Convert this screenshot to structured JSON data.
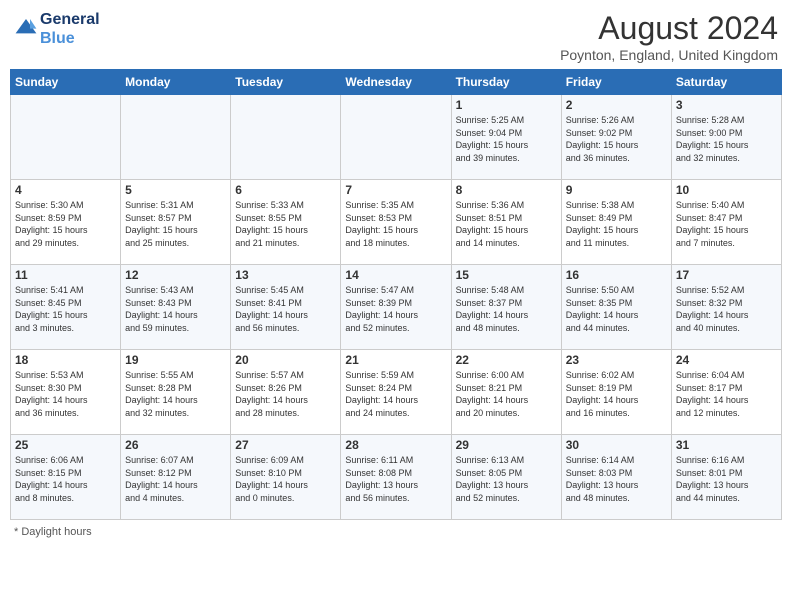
{
  "header": {
    "logo_line1": "General",
    "logo_line2": "Blue",
    "month_year": "August 2024",
    "location": "Poynton, England, United Kingdom"
  },
  "days_of_week": [
    "Sunday",
    "Monday",
    "Tuesday",
    "Wednesday",
    "Thursday",
    "Friday",
    "Saturday"
  ],
  "weeks": [
    [
      {
        "day": "",
        "info": ""
      },
      {
        "day": "",
        "info": ""
      },
      {
        "day": "",
        "info": ""
      },
      {
        "day": "",
        "info": ""
      },
      {
        "day": "1",
        "info": "Sunrise: 5:25 AM\nSunset: 9:04 PM\nDaylight: 15 hours\nand 39 minutes."
      },
      {
        "day": "2",
        "info": "Sunrise: 5:26 AM\nSunset: 9:02 PM\nDaylight: 15 hours\nand 36 minutes."
      },
      {
        "day": "3",
        "info": "Sunrise: 5:28 AM\nSunset: 9:00 PM\nDaylight: 15 hours\nand 32 minutes."
      }
    ],
    [
      {
        "day": "4",
        "info": "Sunrise: 5:30 AM\nSunset: 8:59 PM\nDaylight: 15 hours\nand 29 minutes."
      },
      {
        "day": "5",
        "info": "Sunrise: 5:31 AM\nSunset: 8:57 PM\nDaylight: 15 hours\nand 25 minutes."
      },
      {
        "day": "6",
        "info": "Sunrise: 5:33 AM\nSunset: 8:55 PM\nDaylight: 15 hours\nand 21 minutes."
      },
      {
        "day": "7",
        "info": "Sunrise: 5:35 AM\nSunset: 8:53 PM\nDaylight: 15 hours\nand 18 minutes."
      },
      {
        "day": "8",
        "info": "Sunrise: 5:36 AM\nSunset: 8:51 PM\nDaylight: 15 hours\nand 14 minutes."
      },
      {
        "day": "9",
        "info": "Sunrise: 5:38 AM\nSunset: 8:49 PM\nDaylight: 15 hours\nand 11 minutes."
      },
      {
        "day": "10",
        "info": "Sunrise: 5:40 AM\nSunset: 8:47 PM\nDaylight: 15 hours\nand 7 minutes."
      }
    ],
    [
      {
        "day": "11",
        "info": "Sunrise: 5:41 AM\nSunset: 8:45 PM\nDaylight: 15 hours\nand 3 minutes."
      },
      {
        "day": "12",
        "info": "Sunrise: 5:43 AM\nSunset: 8:43 PM\nDaylight: 14 hours\nand 59 minutes."
      },
      {
        "day": "13",
        "info": "Sunrise: 5:45 AM\nSunset: 8:41 PM\nDaylight: 14 hours\nand 56 minutes."
      },
      {
        "day": "14",
        "info": "Sunrise: 5:47 AM\nSunset: 8:39 PM\nDaylight: 14 hours\nand 52 minutes."
      },
      {
        "day": "15",
        "info": "Sunrise: 5:48 AM\nSunset: 8:37 PM\nDaylight: 14 hours\nand 48 minutes."
      },
      {
        "day": "16",
        "info": "Sunrise: 5:50 AM\nSunset: 8:35 PM\nDaylight: 14 hours\nand 44 minutes."
      },
      {
        "day": "17",
        "info": "Sunrise: 5:52 AM\nSunset: 8:32 PM\nDaylight: 14 hours\nand 40 minutes."
      }
    ],
    [
      {
        "day": "18",
        "info": "Sunrise: 5:53 AM\nSunset: 8:30 PM\nDaylight: 14 hours\nand 36 minutes."
      },
      {
        "day": "19",
        "info": "Sunrise: 5:55 AM\nSunset: 8:28 PM\nDaylight: 14 hours\nand 32 minutes."
      },
      {
        "day": "20",
        "info": "Sunrise: 5:57 AM\nSunset: 8:26 PM\nDaylight: 14 hours\nand 28 minutes."
      },
      {
        "day": "21",
        "info": "Sunrise: 5:59 AM\nSunset: 8:24 PM\nDaylight: 14 hours\nand 24 minutes."
      },
      {
        "day": "22",
        "info": "Sunrise: 6:00 AM\nSunset: 8:21 PM\nDaylight: 14 hours\nand 20 minutes."
      },
      {
        "day": "23",
        "info": "Sunrise: 6:02 AM\nSunset: 8:19 PM\nDaylight: 14 hours\nand 16 minutes."
      },
      {
        "day": "24",
        "info": "Sunrise: 6:04 AM\nSunset: 8:17 PM\nDaylight: 14 hours\nand 12 minutes."
      }
    ],
    [
      {
        "day": "25",
        "info": "Sunrise: 6:06 AM\nSunset: 8:15 PM\nDaylight: 14 hours\nand 8 minutes."
      },
      {
        "day": "26",
        "info": "Sunrise: 6:07 AM\nSunset: 8:12 PM\nDaylight: 14 hours\nand 4 minutes."
      },
      {
        "day": "27",
        "info": "Sunrise: 6:09 AM\nSunset: 8:10 PM\nDaylight: 14 hours\nand 0 minutes."
      },
      {
        "day": "28",
        "info": "Sunrise: 6:11 AM\nSunset: 8:08 PM\nDaylight: 13 hours\nand 56 minutes."
      },
      {
        "day": "29",
        "info": "Sunrise: 6:13 AM\nSunset: 8:05 PM\nDaylight: 13 hours\nand 52 minutes."
      },
      {
        "day": "30",
        "info": "Sunrise: 6:14 AM\nSunset: 8:03 PM\nDaylight: 13 hours\nand 48 minutes."
      },
      {
        "day": "31",
        "info": "Sunrise: 6:16 AM\nSunset: 8:01 PM\nDaylight: 13 hours\nand 44 minutes."
      }
    ]
  ],
  "footer": "Daylight hours"
}
